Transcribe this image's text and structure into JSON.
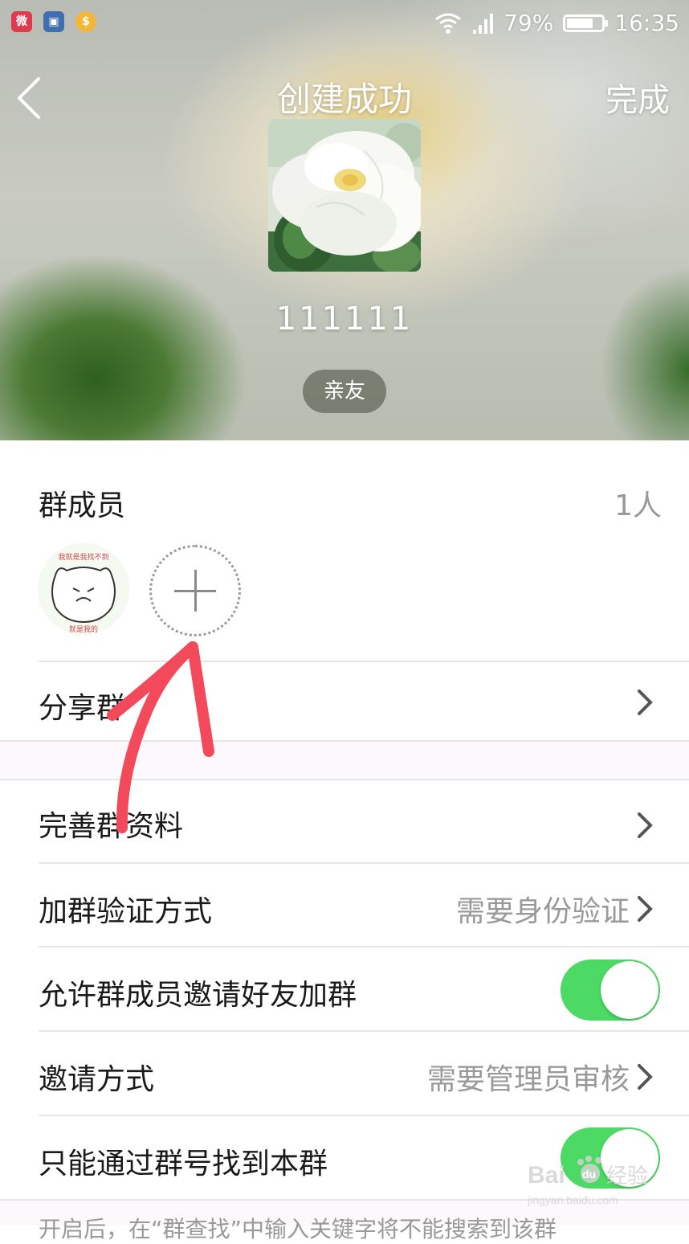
{
  "status_bar": {
    "app_icons": [
      "weibo-icon",
      "gallery-icon",
      "coin-icon"
    ],
    "signal": "cellular-signal-icon",
    "wifi": "wifi-icon",
    "battery_percent": "79%",
    "battery_level": 0.79,
    "time": "16:35"
  },
  "nav": {
    "back_icon": "back-chevron-icon",
    "title": "创建成功",
    "done_label": "完成"
  },
  "group": {
    "name": "111111",
    "tag": "亲友",
    "avatar_image": "white-flower-image"
  },
  "members": {
    "title": "群成员",
    "count": "1人",
    "member_avatar_image": "cartoon-cat-sticker",
    "member_avatar_text_top": "我就是我找不到",
    "member_avatar_text_bottom": "就是我的",
    "add_icon": "plus-icon"
  },
  "rows": {
    "share": {
      "label": "分享群"
    },
    "complete_info": {
      "label": "完善群资料"
    },
    "verify": {
      "label": "加群验证方式",
      "value": "需要身份验证"
    },
    "allow_invite": {
      "label": "允许群成员邀请好友加群",
      "toggle_on": true
    },
    "invite_method": {
      "label": "邀请方式",
      "value": "需要管理员审核"
    },
    "find_only": {
      "label": "只能通过群号找到本群",
      "toggle_on": true
    }
  },
  "footer_note": "开启后，在“群查找”中输入关键字将不能搜索到该群",
  "watermark": {
    "logo_text": "Bai",
    "logo_suffix": "du",
    "label": "经验",
    "url": "jingyan.baidu.com"
  },
  "colors": {
    "toggle_on": "#4cd964",
    "annotation_arrow": "#f24a5a",
    "section_gap": "#fcf8fb",
    "secondary_text": "#999999"
  }
}
